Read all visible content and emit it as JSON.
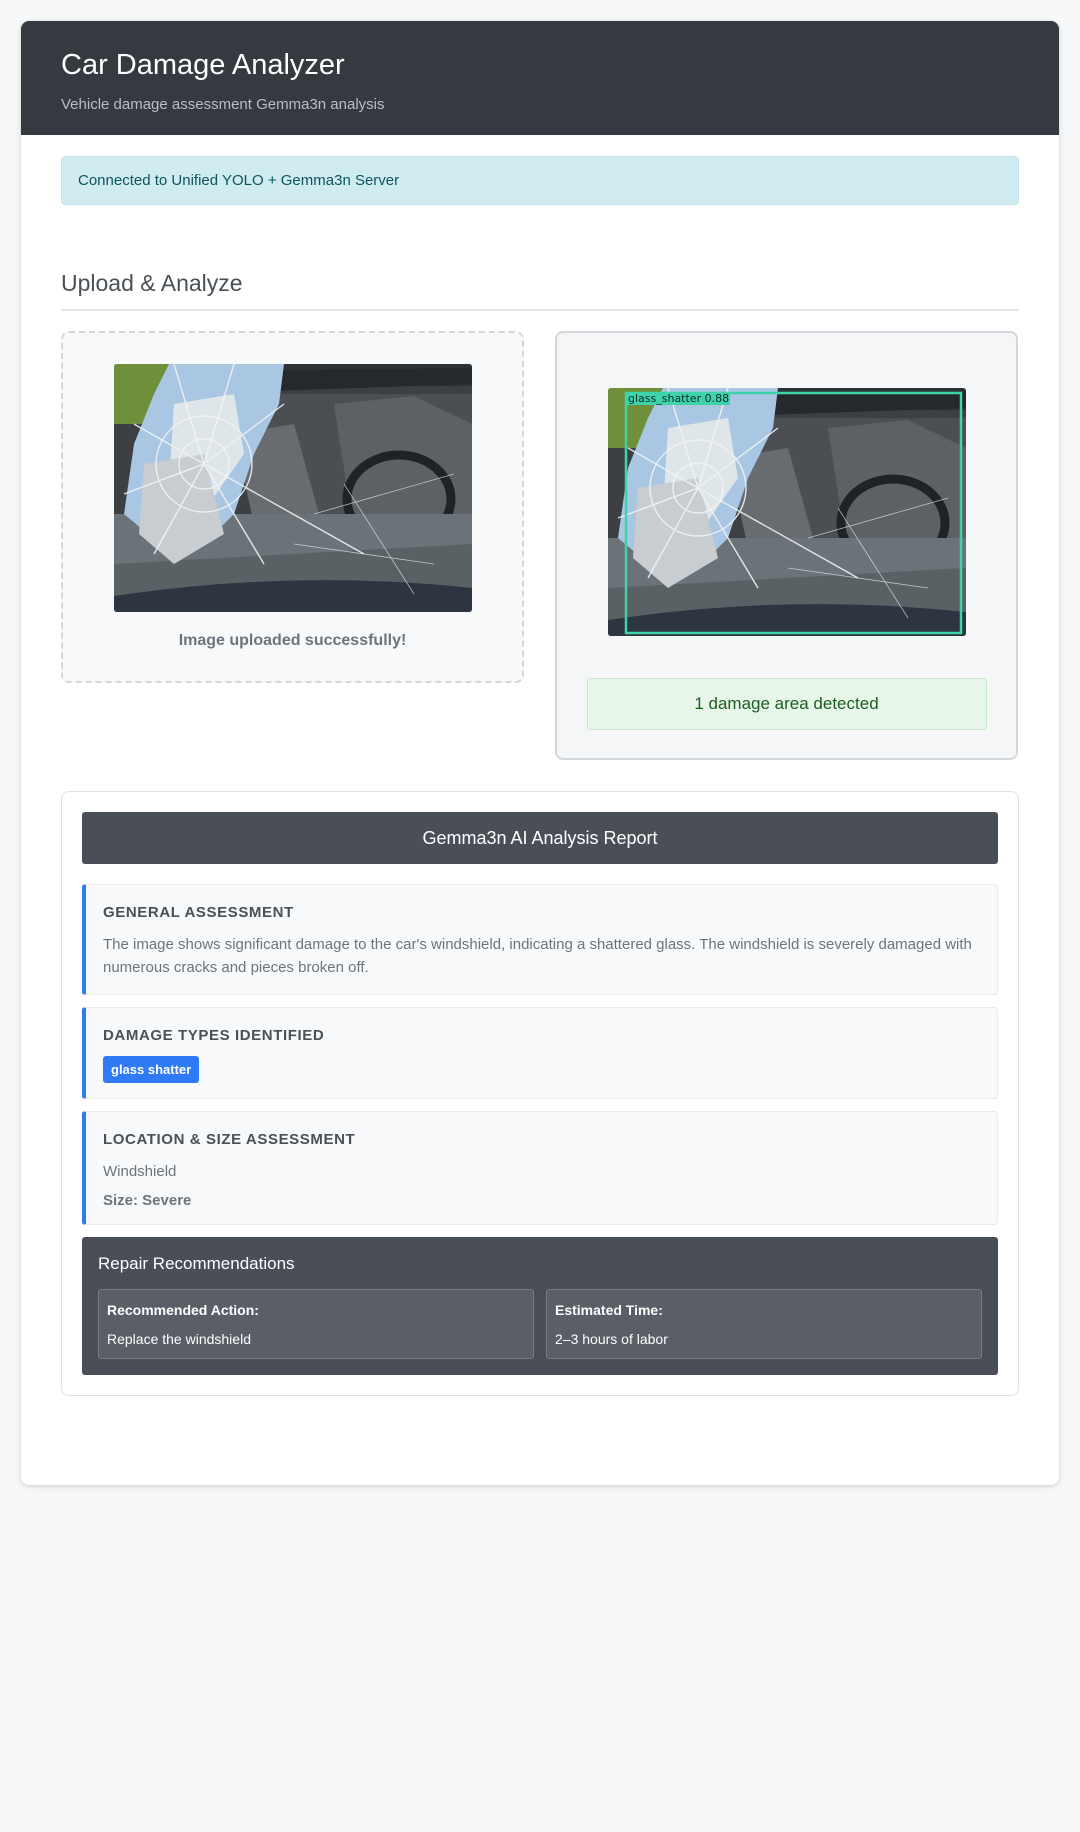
{
  "header": {
    "title": "Car Damage Analyzer",
    "subtitle": "Vehicle damage assessment Gemma3n analysis"
  },
  "connection": {
    "status_text": "Connected to Unified YOLO + Gemma3n Server"
  },
  "upload_section": {
    "title": "Upload & Analyze",
    "upload_status": "Image uploaded successfully!",
    "detection": {
      "label": "glass_shatter",
      "confidence": "0.88",
      "summary": "1 damage area detected"
    }
  },
  "report": {
    "title": "Gemma3n AI Analysis Report",
    "general": {
      "title": "GENERAL ASSESSMENT",
      "text": "The image shows significant damage to the car's windshield, indicating a shattered glass. The windshield is severely damaged with numerous cracks and pieces broken off."
    },
    "damage_types": {
      "title": "DAMAGE TYPES IDENTIFIED",
      "tags": [
        "glass shatter"
      ]
    },
    "location": {
      "title": "LOCATION & SIZE ASSESSMENT",
      "location": "Windshield",
      "size": "Size: Severe"
    },
    "repair": {
      "title": "Repair Recommendations",
      "action_label": "Recommended Action:",
      "action_value": "Replace the windshield",
      "time_label": "Estimated Time:",
      "time_value": "2–3 hours of labor"
    }
  },
  "colors": {
    "header_bg": "#343a40",
    "accent_blue": "#2f7bf5",
    "detection_box": "#3ed3a8",
    "alert_bg": "#d1ecf1",
    "success_bg": "#e8f5e9"
  }
}
